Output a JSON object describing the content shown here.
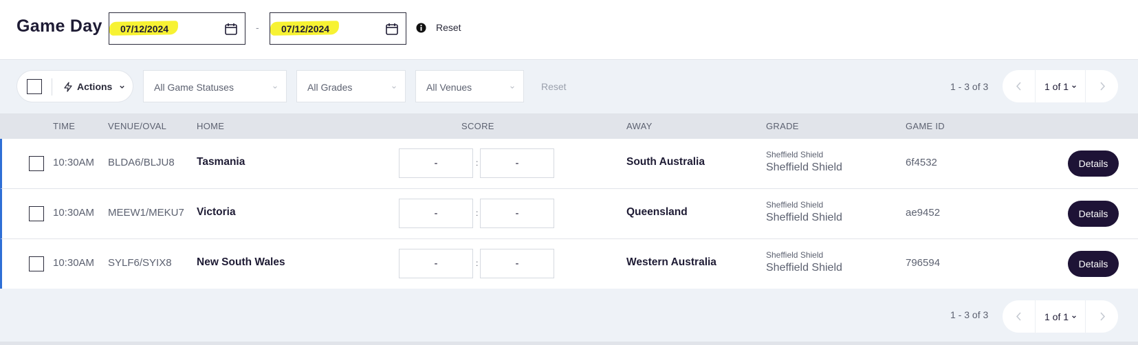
{
  "header": {
    "title": "Game Day",
    "date_from": "07/12/2024",
    "date_separator": "-",
    "date_to": "07/12/2024",
    "reset_label": "Reset"
  },
  "filters": {
    "actions_label": "Actions",
    "game_status": "All Game Statuses",
    "grades": "All Grades",
    "venues": "All Venues",
    "reset_label": "Reset"
  },
  "pagination": {
    "range": "1 - 3 of 3",
    "page": "1 of 1"
  },
  "table": {
    "columns": {
      "time": "TIME",
      "venue": "VENUE/OVAL",
      "home": "HOME",
      "score": "SCORE",
      "away": "AWAY",
      "grade": "GRADE",
      "game_id": "GAME ID"
    },
    "rows": [
      {
        "time": "10:30AM",
        "venue": "BLDA6/BLJU8",
        "home": "Tasmania",
        "home_score": "-",
        "away_score": "-",
        "away": "South Australia",
        "grade_top": "Sheffield Shield",
        "grade": "Sheffield Shield",
        "game_id": "6f4532",
        "action": "Details"
      },
      {
        "time": "10:30AM",
        "venue": "MEEW1/MEKU7",
        "home": "Victoria",
        "home_score": "-",
        "away_score": "-",
        "away": "Queensland",
        "grade_top": "Sheffield Shield",
        "grade": "Sheffield Shield",
        "game_id": "ae9452",
        "action": "Details"
      },
      {
        "time": "10:30AM",
        "venue": "SYLF6/SYIX8",
        "home": "New South Wales",
        "home_score": "-",
        "away_score": "-",
        "away": "Western Australia",
        "grade_top": "Sheffield Shield",
        "grade": "Sheffield Shield",
        "game_id": "796594",
        "action": "Details"
      }
    ]
  },
  "colors": {
    "primary_dark": "#1e1336",
    "highlight": "#f7f233",
    "row_accent": "#2f6fd6",
    "bar_background": "#eef2f7"
  },
  "icons": {
    "calendar": "calendar-icon",
    "info": "info-icon",
    "bolt": "lightning-icon",
    "chevron": "chevron-down-icon",
    "prev": "chevron-left-icon",
    "next": "chevron-right-icon"
  }
}
